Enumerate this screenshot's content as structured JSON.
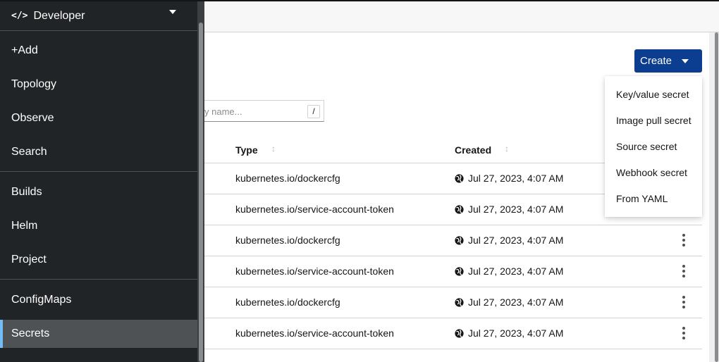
{
  "perspective": {
    "icon": "code-icon",
    "label": "Developer"
  },
  "nav": {
    "add": "+Add",
    "topology": "Topology",
    "observe": "Observe",
    "search": "Search",
    "builds": "Builds",
    "helm": "Helm",
    "project": "Project",
    "configmaps": "ConfigMaps",
    "secrets": "Secrets"
  },
  "toolbar": {
    "create_label": "Create"
  },
  "create_menu": [
    "Key/value secret",
    "Image pull secret",
    "Source secret",
    "Webhook secret",
    "From YAML"
  ],
  "filter": {
    "placeholder": "y name...",
    "shortcut": "/"
  },
  "table": {
    "columns": {
      "type": "Type",
      "created": "Created"
    },
    "rows": [
      {
        "type": "kubernetes.io/dockercfg",
        "created": "Jul 27, 2023, 4:07 AM"
      },
      {
        "type": "kubernetes.io/service-account-token",
        "created": "Jul 27, 2023, 4:07 AM"
      },
      {
        "type": "kubernetes.io/dockercfg",
        "created": "Jul 27, 2023, 4:07 AM"
      },
      {
        "type": "kubernetes.io/service-account-token",
        "created": "Jul 27, 2023, 4:07 AM"
      },
      {
        "type": "kubernetes.io/dockercfg",
        "created": "Jul 27, 2023, 4:07 AM"
      },
      {
        "type": "kubernetes.io/service-account-token",
        "created": "Jul 27, 2023, 4:07 AM"
      }
    ]
  },
  "colors": {
    "accent": "#0b3d91",
    "sidebar": "#212427",
    "active_indicator": "#73bcf7"
  }
}
